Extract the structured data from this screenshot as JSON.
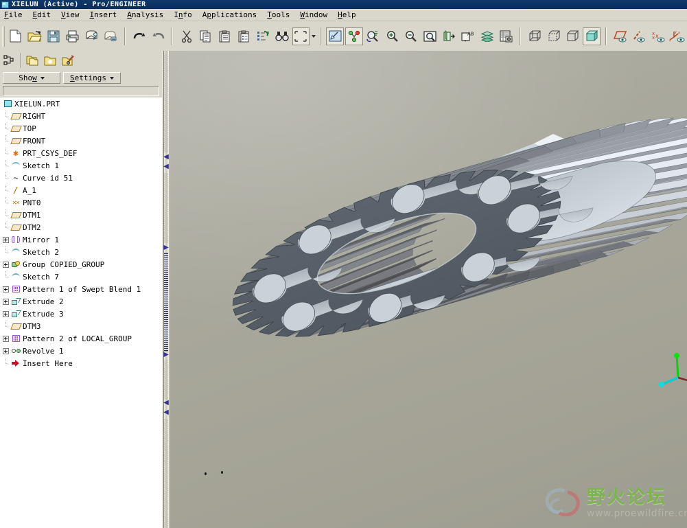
{
  "window": {
    "title": "XIELUN (Active) - Pro/ENGINEER",
    "icon": "part-icon"
  },
  "menubar": {
    "items": [
      {
        "label": "File",
        "mnemonic": "F"
      },
      {
        "label": "Edit",
        "mnemonic": "E"
      },
      {
        "label": "View",
        "mnemonic": "V"
      },
      {
        "label": "Insert",
        "mnemonic": "I"
      },
      {
        "label": "Analysis",
        "mnemonic": "A"
      },
      {
        "label": "Info",
        "mnemonic": "n"
      },
      {
        "label": "Applications",
        "mnemonic": "p"
      },
      {
        "label": "Tools",
        "mnemonic": "T"
      },
      {
        "label": "Window",
        "mnemonic": "W"
      },
      {
        "label": "Help",
        "mnemonic": "H"
      }
    ]
  },
  "toolbar": {
    "groups": [
      {
        "name": "file-group",
        "buttons": [
          {
            "icon": "new-file-icon",
            "label": "New"
          },
          {
            "icon": "open-folder-icon",
            "label": "Open"
          },
          {
            "icon": "save-icon",
            "label": "Save"
          },
          {
            "icon": "print-icon",
            "label": "Print"
          },
          {
            "icon": "mail-attach-icon",
            "label": "Send Mail"
          },
          {
            "icon": "mail-icon",
            "label": "Mail Recipient"
          }
        ]
      },
      {
        "name": "edit-group",
        "buttons": [
          {
            "icon": "undo-icon",
            "label": "Undo"
          },
          {
            "icon": "redo-icon",
            "label": "Redo"
          },
          {
            "icon": "cut-icon",
            "label": "Cut"
          },
          {
            "icon": "copy-icon",
            "label": "Copy"
          },
          {
            "icon": "paste-icon",
            "label": "Paste"
          },
          {
            "icon": "paste-special-icon",
            "label": "Paste Special"
          },
          {
            "icon": "regenerate-icon",
            "label": "Regenerate"
          },
          {
            "icon": "find-icon",
            "label": "Find"
          },
          {
            "icon": "selection-filter-icon",
            "label": "Selection Filter",
            "has_dropdown": true
          }
        ]
      },
      {
        "name": "view-group",
        "buttons": [
          {
            "icon": "repaint-icon",
            "label": "Repaint",
            "active": true
          },
          {
            "icon": "spin-center-icon",
            "label": "Spin Center",
            "active": true
          },
          {
            "icon": "reorient-icon",
            "label": "Reorient"
          },
          {
            "icon": "zoom-in-icon",
            "label": "Zoom In"
          },
          {
            "icon": "zoom-out-icon",
            "label": "Zoom Out"
          },
          {
            "icon": "refit-icon",
            "label": "Refit"
          },
          {
            "icon": "datum-display-icon",
            "label": "Datum Display"
          },
          {
            "icon": "annotation-icon",
            "label": "Annotation Display",
            "has_dropdown": true
          },
          {
            "icon": "layers-icon",
            "label": "Layers"
          },
          {
            "icon": "saved-views-icon",
            "label": "Saved View List"
          }
        ]
      },
      {
        "name": "display-style-group",
        "buttons": [
          {
            "icon": "wireframe-icon",
            "label": "Wireframe"
          },
          {
            "icon": "hidden-line-icon",
            "label": "Hidden Line"
          },
          {
            "icon": "no-hidden-icon",
            "label": "No Hidden"
          },
          {
            "icon": "shading-icon",
            "label": "Shading",
            "active": true
          }
        ]
      },
      {
        "name": "datum-display-group",
        "buttons": [
          {
            "icon": "datum-plane-icon",
            "label": "Datum Planes"
          },
          {
            "icon": "datum-axis-icon",
            "label": "Datum Axes"
          },
          {
            "icon": "datum-point-icon",
            "label": "Datum Points"
          },
          {
            "icon": "datum-csys-icon",
            "label": "Coordinate Systems"
          }
        ]
      }
    ]
  },
  "model_tree": {
    "toolbar_buttons": [
      {
        "icon": "tree-columns-icon",
        "label": "Tree Columns"
      },
      {
        "icon": "folder-browser-icon",
        "label": "Folder Browser"
      },
      {
        "icon": "favorites-icon",
        "label": "Favorites"
      },
      {
        "icon": "tools-folder-icon",
        "label": "Tools"
      }
    ],
    "show_label": "Show",
    "show_mnemonic": "w",
    "settings_label": "Settings",
    "settings_mnemonic": "S",
    "items": [
      {
        "label": "XIELUN.PRT",
        "icon": "part-icon",
        "depth": 0,
        "expandable": false
      },
      {
        "label": "RIGHT",
        "icon": "plane-icon",
        "depth": 1,
        "expandable": false
      },
      {
        "label": "TOP",
        "icon": "plane-icon",
        "depth": 1,
        "expandable": false
      },
      {
        "label": "FRONT",
        "icon": "plane-icon",
        "depth": 1,
        "expandable": false
      },
      {
        "label": "PRT_CSYS_DEF",
        "icon": "csys-icon",
        "depth": 1,
        "expandable": false
      },
      {
        "label": "Sketch 1",
        "icon": "sketch-icon",
        "depth": 1,
        "expandable": false
      },
      {
        "label": "Curve id 51",
        "icon": "curve-icon",
        "depth": 1,
        "expandable": false
      },
      {
        "label": "A_1",
        "icon": "axis-icon",
        "depth": 1,
        "expandable": false
      },
      {
        "label": "PNT0",
        "icon": "point-icon",
        "depth": 1,
        "expandable": false
      },
      {
        "label": "DTM1",
        "icon": "plane-icon",
        "depth": 1,
        "expandable": false
      },
      {
        "label": "DTM2",
        "icon": "plane-icon",
        "depth": 1,
        "expandable": false
      },
      {
        "label": "Mirror 1",
        "icon": "mirror-icon",
        "depth": 1,
        "expandable": true
      },
      {
        "label": "Sketch 2",
        "icon": "sketch-icon",
        "depth": 1,
        "expandable": false
      },
      {
        "label": "Group COPIED_GROUP",
        "icon": "group-icon",
        "depth": 1,
        "expandable": true
      },
      {
        "label": "Sketch 7",
        "icon": "sketch-icon",
        "depth": 1,
        "expandable": false
      },
      {
        "label": "Pattern 1 of Swept Blend 1",
        "icon": "pattern-icon",
        "depth": 1,
        "expandable": true
      },
      {
        "label": "Extrude 2",
        "icon": "extrude-icon",
        "depth": 1,
        "expandable": true
      },
      {
        "label": "Extrude 3",
        "icon": "extrude-icon",
        "depth": 1,
        "expandable": true
      },
      {
        "label": "DTM3",
        "icon": "plane-icon",
        "depth": 1,
        "expandable": false
      },
      {
        "label": "Pattern 2 of LOCAL_GROUP",
        "icon": "pattern-icon",
        "depth": 1,
        "expandable": true
      },
      {
        "label": "Revolve 1",
        "icon": "revolve-icon",
        "depth": 1,
        "expandable": true
      },
      {
        "label": "Insert Here",
        "icon": "insert-here-icon",
        "depth": 1,
        "expandable": false
      }
    ]
  },
  "viewport": {
    "model_name": "XIELUN.PRT",
    "model_description": "helical gear with lightening holes",
    "display_style": "Shading",
    "coordinate_system": {
      "label": "PRT_CSYS_DEF",
      "x_axis_color": "#cc1111",
      "y_axis_color": "#11cc11",
      "z_axis_color": "#11cccc"
    },
    "colors": {
      "background_top": "#b2b1a6",
      "background_bottom": "#9d9c90",
      "gear_face": "#59616b",
      "gear_teeth_light": "#d6dde2",
      "gear_teeth_mid": "#aab4bd",
      "gear_teeth_dark": "#6f7a85",
      "bore_inner": "#c3cdd4"
    }
  },
  "watermark": {
    "text_cn": "野火论坛",
    "text_en": "www.proewildfire.cn",
    "color_cn": "#7ab648",
    "color_en": "#b9b8ae"
  }
}
